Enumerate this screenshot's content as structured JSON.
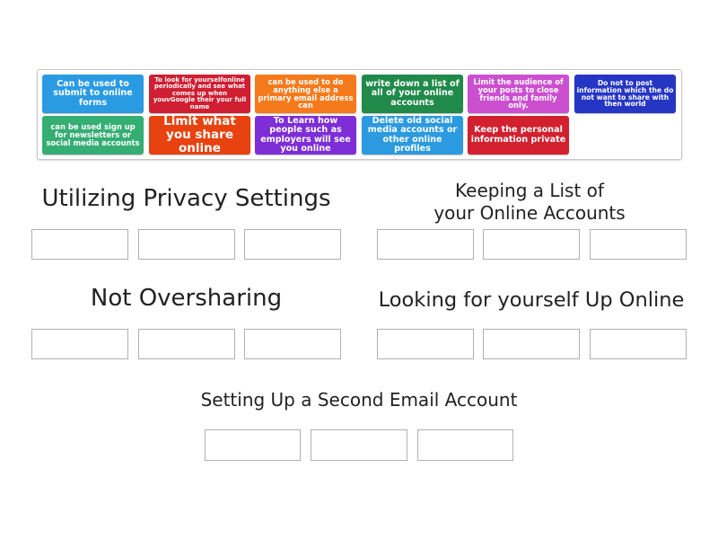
{
  "tiles": [
    {
      "text": "Can be used to submit to online forms",
      "color": "#2a9be3"
    },
    {
      "text": "To look for yourselfonline periodically and see what comes up when youvGoogle their your full name",
      "color": "#d01e32"
    },
    {
      "text": "can be used to do anything else a primary email address can",
      "color": "#f57a1c"
    },
    {
      "text": "write down a list of all of your online accounts",
      "color": "#1f8a4a"
    },
    {
      "text": "Limit the audience of your posts to close friends and family only.",
      "color": "#cc4fd0"
    },
    {
      "text": "Do not to post information which the do not want to share with then world",
      "color": "#2636c4"
    },
    {
      "text": "can be used sign up for newsletters or social media accounts",
      "color": "#35ae74"
    },
    {
      "text": "Limit what you share online",
      "color": "#e7420f"
    },
    {
      "text": "To Learn how people such as employers will see you online",
      "color": "#7d2ed6"
    },
    {
      "text": "Delete old social media accounts or other online profiles",
      "color": "#2b9ae0"
    },
    {
      "text": "Keep the personal information private",
      "color": "#d2202f"
    }
  ],
  "categories": [
    {
      "title": "Utilizing Privacy Settings"
    },
    {
      "title_line1": "Keeping a List of",
      "title_line2": "your Online Accounts"
    },
    {
      "title": "Not Oversharing"
    },
    {
      "title": "Looking for yourself Up Online"
    },
    {
      "title": "Setting Up a Second Email Account"
    }
  ]
}
